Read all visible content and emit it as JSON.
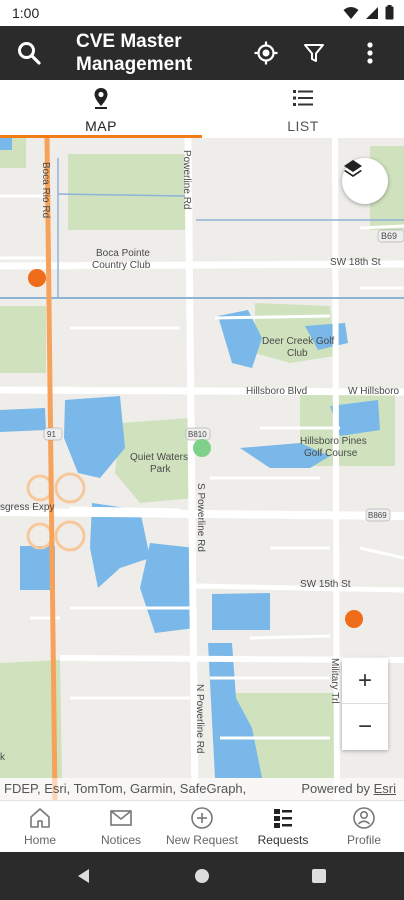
{
  "status_bar": {
    "time": "1:00"
  },
  "app_bar": {
    "title": "CVE Master Management"
  },
  "tabs": [
    {
      "label": "MAP",
      "icon": "map-pin-icon",
      "active": true
    },
    {
      "label": "LIST",
      "icon": "list-icon",
      "active": false
    }
  ],
  "map": {
    "labels": {
      "boca_rio_rd": "Boca Rio Rd",
      "powerline_rd_north": "Powerline Rd",
      "sw_18th_st": "SW 18th St",
      "boca_pointe_1": "Boca Pointe",
      "boca_pointe_2": "Country Club",
      "b69_top": "B69",
      "deer_creek_1": "Deer Creek Golf",
      "deer_creek_2": "Club",
      "hillsboro_blvd": "Hillsboro Blvd",
      "w_hillsboro": "W Hillsboro",
      "hillsboro_pines_1": "Hillsboro Pines",
      "hillsboro_pines_2": "Golf Course",
      "quiet_waters_1": "Quiet Waters",
      "quiet_waters_2": "Park",
      "b810": "B810",
      "shield_91": "91",
      "b869": "B869",
      "sgress_expy": "sgress Expy",
      "s_powerline_rd": "S Powerline Rd",
      "sw_15th_st": "SW 15th St",
      "military_trl": "Military Trl",
      "n_powerline_rd": "N Powerline Rd",
      "edge_k": "k"
    },
    "markers": [
      {
        "color": "#ef6c1a"
      },
      {
        "color": "#7fd18a"
      },
      {
        "color": "#ef6c1a"
      }
    ],
    "layers_button_icon": "layers-icon",
    "zoom_in_label": "+",
    "zoom_out_label": "−",
    "attribution": "FDEP, Esri, TomTom, Garmin, SafeGraph,",
    "powered_by": "Powered by",
    "powered_by_brand": "Esri"
  },
  "bottom_nav": [
    {
      "label": "Home",
      "icon": "home-icon",
      "active": false
    },
    {
      "label": "Notices",
      "icon": "mail-icon",
      "active": false
    },
    {
      "label": "New Request",
      "icon": "add-circle-icon",
      "active": false
    },
    {
      "label": "Requests",
      "icon": "requests-list-icon",
      "active": true
    },
    {
      "label": "Profile",
      "icon": "profile-icon",
      "active": false
    }
  ]
}
